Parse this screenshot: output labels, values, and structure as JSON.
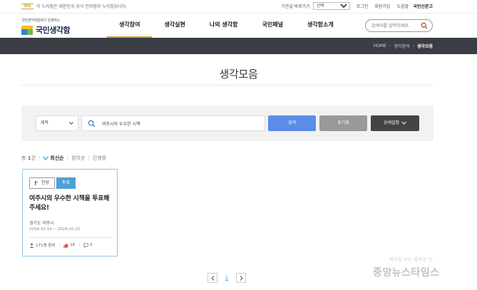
{
  "util": {
    "gov_badge": "EG",
    "gov_text": "이 누리집은 대한민국 공식 전자정부 누리집입니다.",
    "related_label": "기관실 바로가기",
    "related_select": "선택",
    "login": "로그인",
    "join": "회원가입",
    "help": "도움말",
    "shinmungo": "국민신문고"
  },
  "logo": {
    "tagline": "국민권익위원회가 운영하는",
    "name": "국민생각함"
  },
  "gnb": [
    {
      "label": "생각참여",
      "active": true
    },
    {
      "label": "생각실현",
      "active": false
    },
    {
      "label": "나의 생각함",
      "active": false
    },
    {
      "label": "국민패널",
      "active": false
    },
    {
      "label": "생각함소개",
      "active": false
    }
  ],
  "header_search": {
    "placeholder": "검색어를 입력하세요."
  },
  "breadcrumb": {
    "home": "HOME",
    "level1": "생각참여",
    "current": "생각모음"
  },
  "page_title": "생각모음",
  "search": {
    "type_value": "제목",
    "keyword_value": "여주시의 우수한 시책",
    "search_btn": "검색",
    "reset_btn": "초기화",
    "detail_btn": "상세설정"
  },
  "sort": {
    "count_prefix": "총",
    "count_value": "1",
    "count_suffix": "건",
    "options": [
      "최신순",
      "참여순",
      "진행중"
    ]
  },
  "cards": [
    {
      "tag_status": "찬성",
      "tag_type": "투표",
      "title": "여주시의 우수한 시책을 투표해주세요!",
      "org": "경기도 여주시",
      "period": "2024.10.14 ~ 2024.10.20",
      "participants": "171명 참여",
      "likes": "16",
      "comments": "0"
    }
  ],
  "pagination": {
    "current": "1"
  },
  "watermark": {
    "small": "세상을 보는 올바른 눈",
    "main": "중앙뉴스타임스"
  },
  "colors": {
    "accent": "#c9a23a",
    "primary_btn": "#5b8de6",
    "subbar": "#3a3d44",
    "vote_tag": "#4d9fd6"
  }
}
